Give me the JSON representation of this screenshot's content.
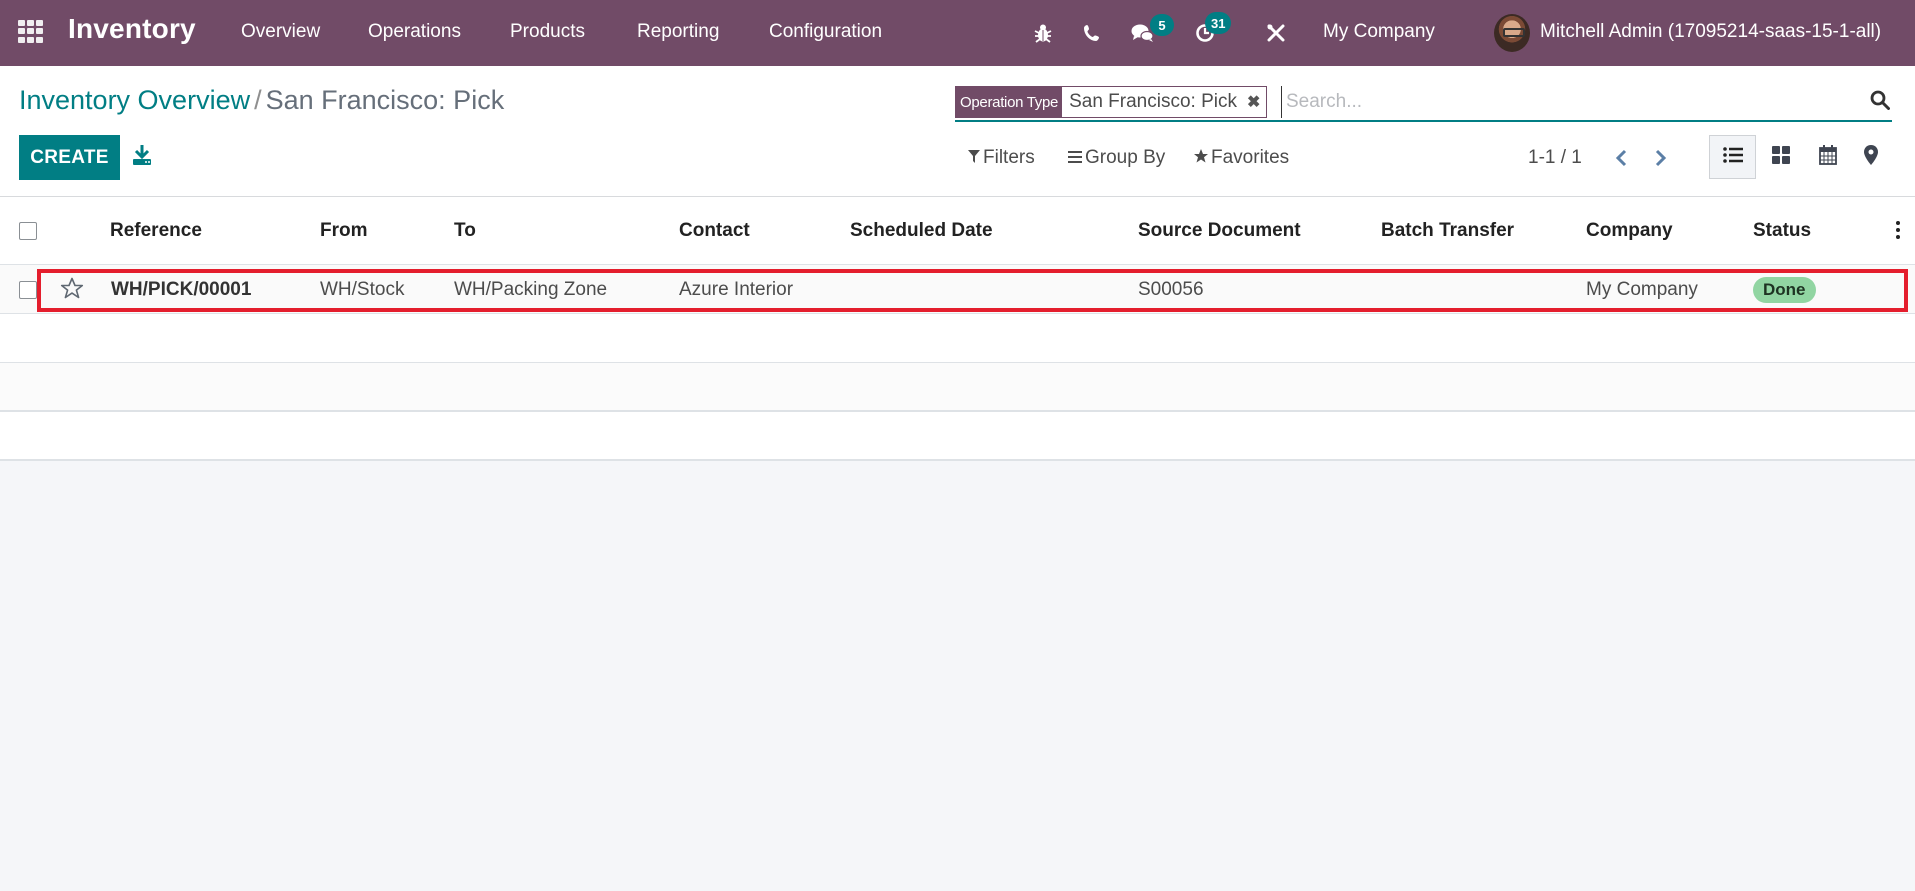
{
  "navbar": {
    "app_name": "Inventory",
    "menu": [
      "Overview",
      "Operations",
      "Products",
      "Reporting",
      "Configuration"
    ],
    "icons": {
      "debug": "bug-icon",
      "phone": "phone-icon",
      "messages": "chat-icon",
      "activities": "clock-icon",
      "tools": "tools-icon"
    },
    "messages_count": "5",
    "activities_count": "31",
    "company": "My Company",
    "user": "Mitchell Admin (17095214-saas-15-1-all)",
    "colors": {
      "brand": "#714b67",
      "badge": "#017e84"
    }
  },
  "control_panel": {
    "breadcrumb": {
      "parent": "Inventory Overview",
      "separator": "/",
      "current": "San Francisco: Pick"
    },
    "create_label": "CREATE",
    "search": {
      "facet_label": "Operation Type",
      "facet_value": "San Francisco: Pick",
      "facet_remove": "✖",
      "placeholder": "Search..."
    },
    "filters_label": "Filters",
    "groupby_label": "Group By",
    "favorites_label": "Favorites",
    "pager": "1-1 / 1",
    "views": [
      "list",
      "kanban",
      "calendar",
      "map"
    ],
    "active_view": "list",
    "colors": {
      "primary": "#017e84"
    }
  },
  "list": {
    "columns": [
      "Reference",
      "From",
      "To",
      "Contact",
      "Scheduled Date",
      "Source Document",
      "Batch Transfer",
      "Company",
      "Status"
    ],
    "rows": [
      {
        "reference": "WH/PICK/00001",
        "from": "WH/Stock",
        "to": "WH/Packing Zone",
        "contact": "Azure Interior",
        "scheduled_date": "",
        "source_document": "S00056",
        "batch_transfer": "",
        "company": "My Company",
        "status": "Done",
        "starred": false
      }
    ],
    "colors": {
      "status_done": "#91d5a2",
      "highlight": "#e41e2d"
    }
  }
}
